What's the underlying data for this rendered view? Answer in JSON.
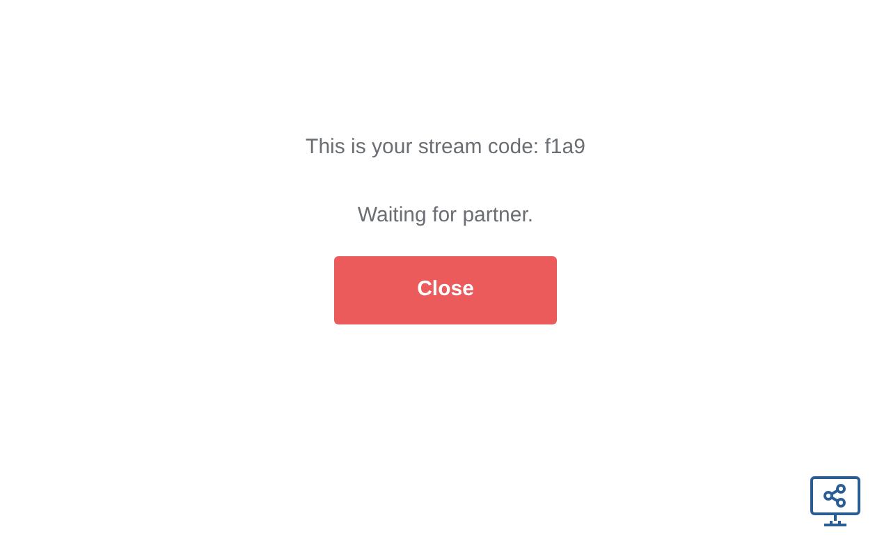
{
  "stream_code_message": "This is your stream code: f1a9",
  "status": "Waiting for partner.",
  "close_button": "Close"
}
